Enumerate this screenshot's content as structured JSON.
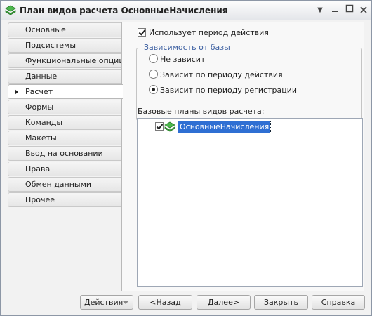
{
  "window": {
    "title": "План видов расчета ОсновныеНачисления"
  },
  "sidebar": {
    "items": [
      {
        "label": "Основные"
      },
      {
        "label": "Подсистемы"
      },
      {
        "label": "Функциональные опции"
      },
      {
        "label": "Данные"
      },
      {
        "label": "Расчет"
      },
      {
        "label": "Формы"
      },
      {
        "label": "Команды"
      },
      {
        "label": "Макеты"
      },
      {
        "label": "Ввод на основании"
      },
      {
        "label": "Права"
      },
      {
        "label": "Обмен данными"
      },
      {
        "label": "Прочее"
      }
    ],
    "active_index": 4
  },
  "main": {
    "uses_period_label": "Использует период действия",
    "uses_period_checked": true,
    "dependency_group_title": "Зависимость от базы",
    "dependency_options": [
      {
        "label": "Не зависит",
        "selected": false
      },
      {
        "label": "Зависит по периоду действия",
        "selected": false
      },
      {
        "label": "Зависит по периоду регистрации",
        "selected": true
      }
    ],
    "base_plans_label": "Базовые планы видов расчета:",
    "base_plans": [
      {
        "name": "ОсновныеНачисления",
        "checked": true,
        "selected": true
      }
    ]
  },
  "buttons": {
    "actions": "Действия",
    "back": "<Назад",
    "next": "Далее>",
    "close": "Закрыть",
    "help": "Справка"
  },
  "colors": {
    "accent": "#3c5fa1",
    "selection": "#2f6fd3",
    "icon_green": "#3a9e3a"
  }
}
